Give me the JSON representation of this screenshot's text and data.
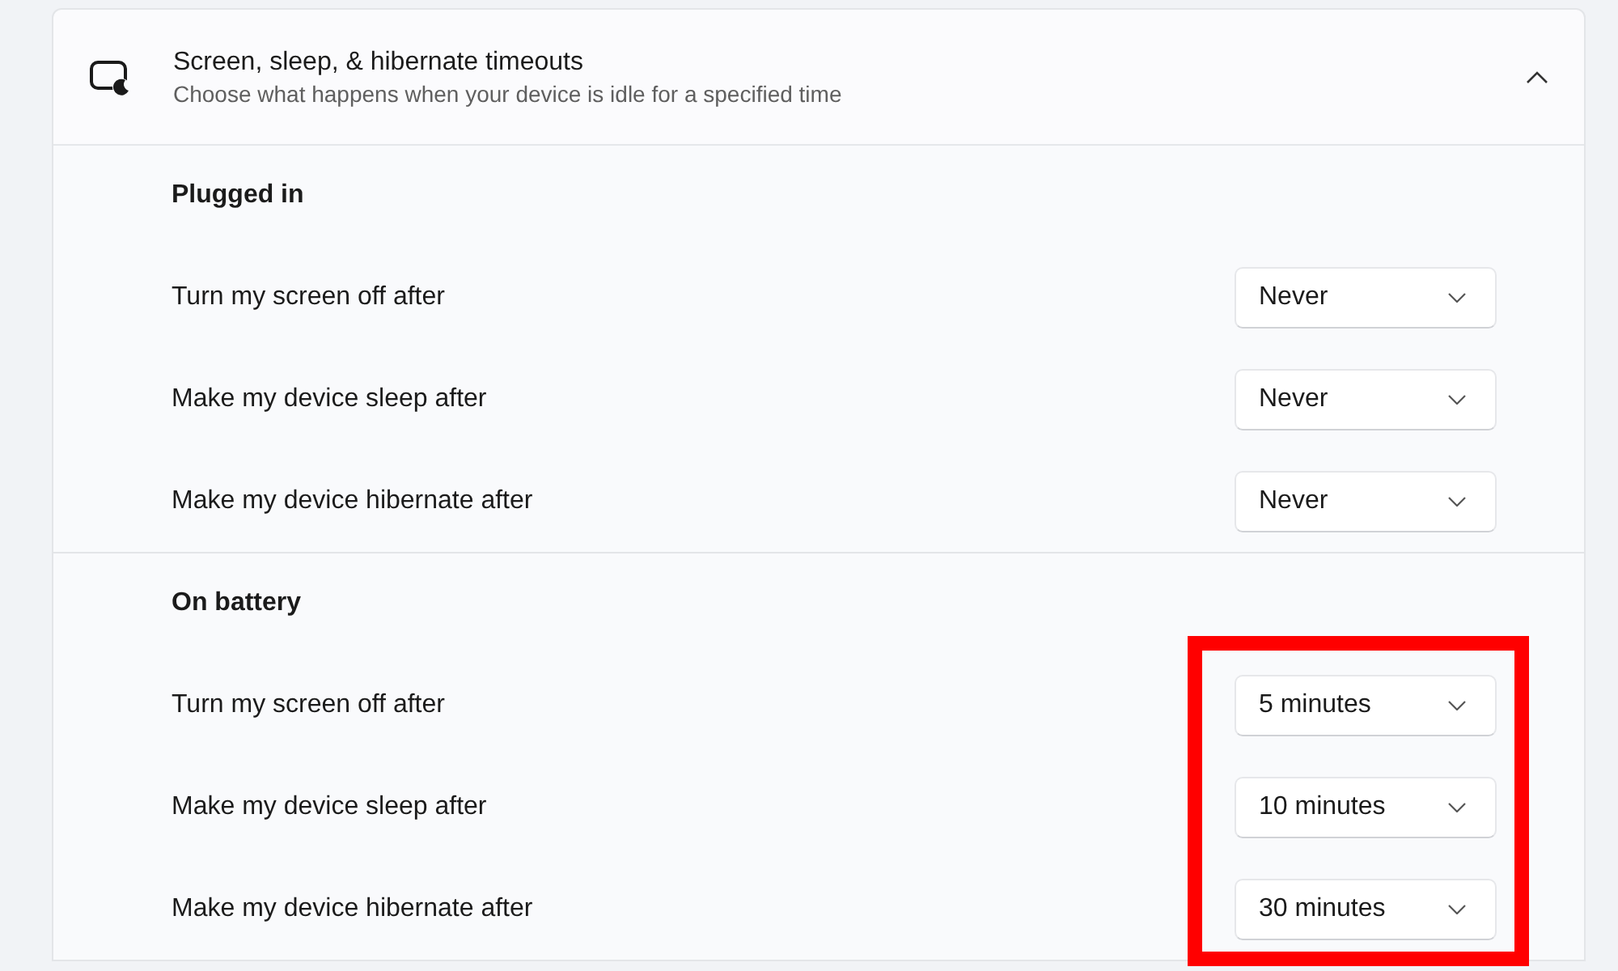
{
  "header": {
    "title": "Screen, sleep, & hibernate timeouts",
    "subtitle": "Choose what happens when your device is idle for a specified time",
    "expanded": true
  },
  "groups": [
    {
      "heading": "Plugged in",
      "highlighted": false,
      "rows": [
        {
          "label": "Turn my screen off after",
          "value": "Never"
        },
        {
          "label": "Make my device sleep after",
          "value": "Never"
        },
        {
          "label": "Make my device hibernate after",
          "value": "Never"
        }
      ]
    },
    {
      "heading": "On battery",
      "highlighted": true,
      "rows": [
        {
          "label": "Turn my screen off after",
          "value": "5 minutes"
        },
        {
          "label": "Make my device sleep after",
          "value": "10 minutes"
        },
        {
          "label": "Make my device hibernate after",
          "value": "30 minutes"
        }
      ]
    }
  ]
}
